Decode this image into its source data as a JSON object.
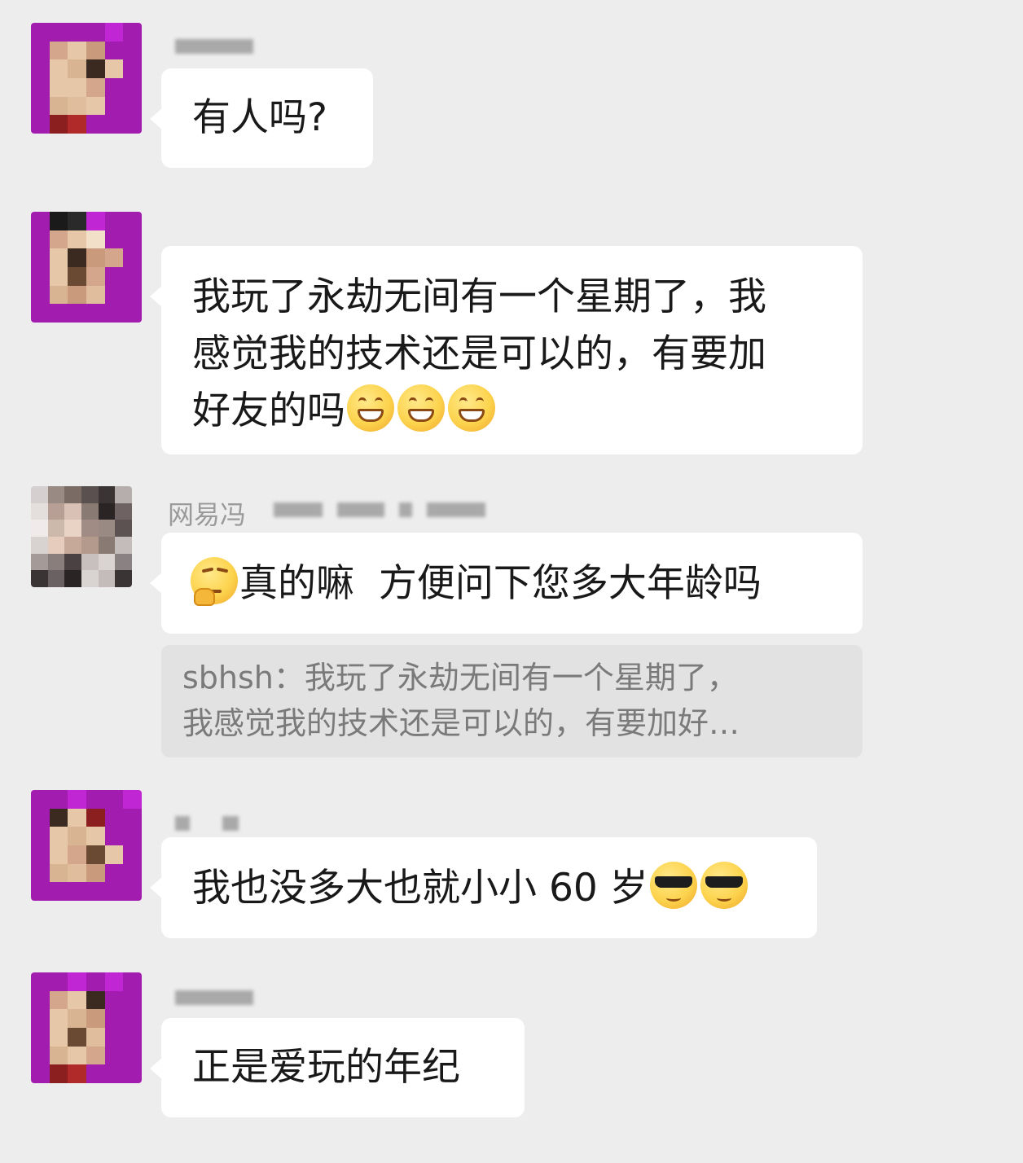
{
  "messages": [
    {
      "text_lines": [
        "有人吗?"
      ]
    },
    {
      "text_lines": [
        "我玩了永劫无间有一个星期了，我",
        "感觉我的技术还是可以的，有要加",
        "好友的吗"
      ],
      "emojis": [
        "grinning-face",
        "grinning-face",
        "grinning-face"
      ]
    },
    {
      "sender_visible": "网易冯",
      "text_lines": [
        "真的嘛  方便问下您多大年龄吗"
      ],
      "emojis": [
        "thinking-face"
      ]
    },
    {
      "quote": {
        "sender": "sbhsh：",
        "lines": [
          "我玩了永劫无间有一个星期了，",
          "我感觉我的技术还是可以的，有要加好…"
        ]
      }
    },
    {
      "text_lines": [
        "我也没多大也就小小 60 岁"
      ],
      "emojis": [
        "sunglasses-face",
        "sunglasses-face"
      ]
    },
    {
      "text_lines": [
        "正是爱玩的年纪"
      ]
    }
  ],
  "colors": {
    "background": "#ededed",
    "bubble": "#ffffff",
    "quote_bg": "#e2e2e2",
    "avatar_purple": "#a21caf"
  }
}
